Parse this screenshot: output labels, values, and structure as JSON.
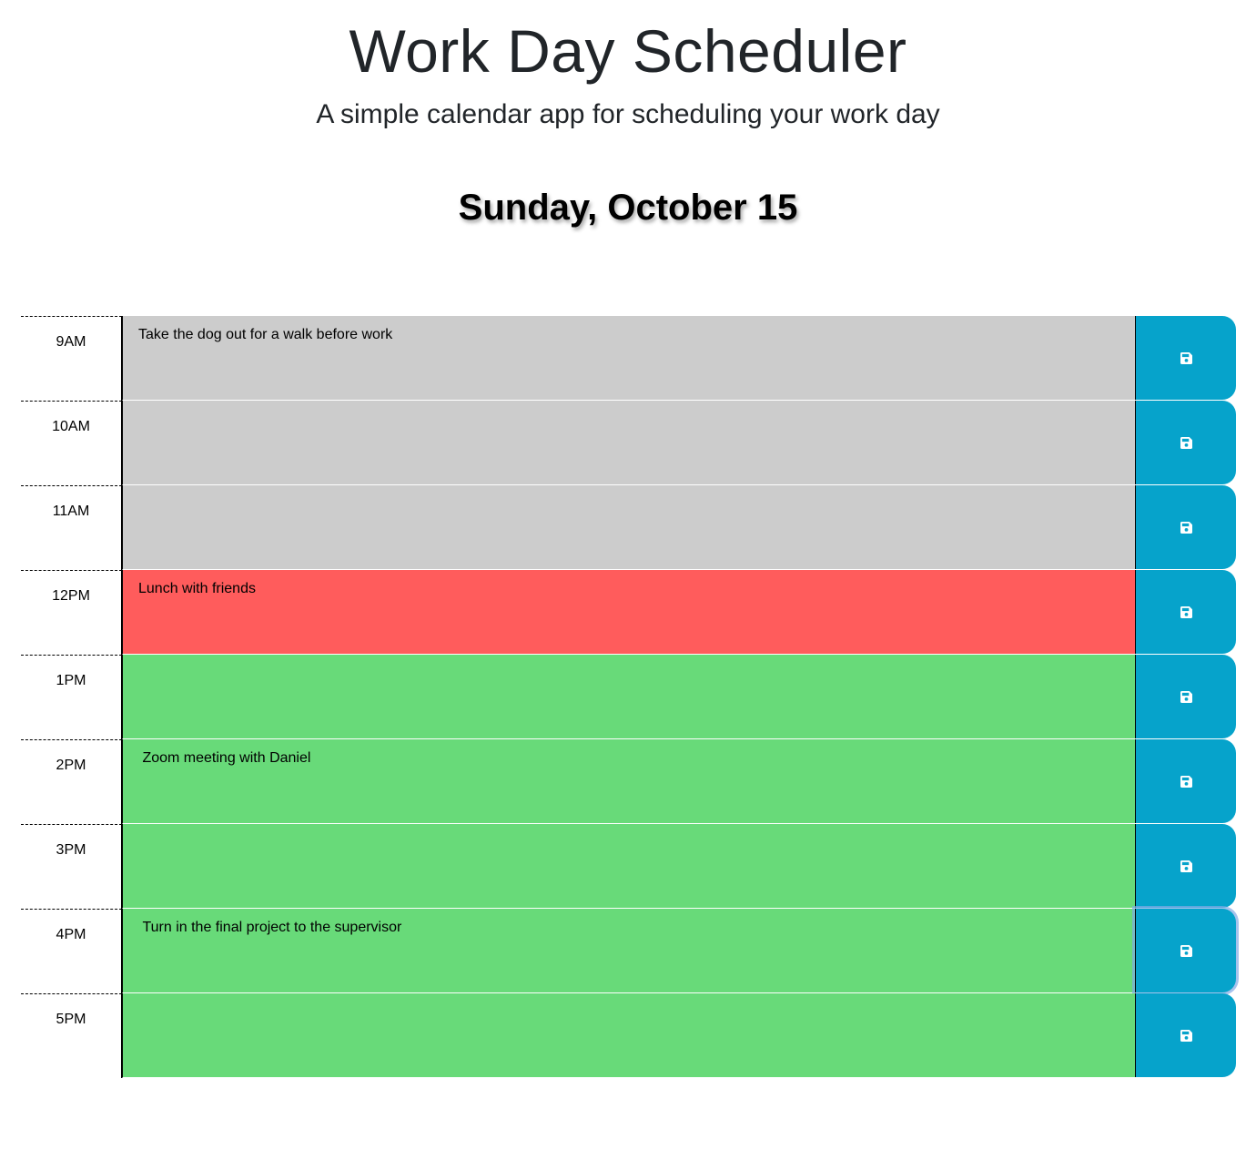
{
  "header": {
    "title": "Work Day Scheduler",
    "subtitle": "A simple calendar app for scheduling your work day",
    "current_day": "Sunday, October 15"
  },
  "colors": {
    "past": "#cccccc",
    "present": "#ff5c5c",
    "future": "#68da79",
    "save_button": "#06a3cb"
  },
  "schedule": [
    {
      "hour": "9AM",
      "text": "Take the dog out for a walk before work",
      "state": "past",
      "save_icon": "floppy-disk-icon"
    },
    {
      "hour": "10AM",
      "text": "",
      "state": "past",
      "save_icon": "floppy-disk-icon"
    },
    {
      "hour": "11AM",
      "text": "",
      "state": "past",
      "save_icon": "floppy-disk-icon"
    },
    {
      "hour": "12PM",
      "text": "Lunch with friends",
      "state": "present",
      "save_icon": "floppy-disk-icon"
    },
    {
      "hour": "1PM",
      "text": "",
      "state": "future",
      "save_icon": "floppy-disk-icon"
    },
    {
      "hour": "2PM",
      "text": " Zoom meeting with Daniel",
      "state": "future",
      "save_icon": "floppy-disk-icon"
    },
    {
      "hour": "3PM",
      "text": "",
      "state": "future",
      "save_icon": "floppy-disk-icon"
    },
    {
      "hour": "4PM",
      "text": " Turn in the final project to the supervisor",
      "state": "future",
      "save_icon": "floppy-disk-icon"
    },
    {
      "hour": "5PM",
      "text": "",
      "state": "future",
      "save_icon": "floppy-disk-icon"
    }
  ]
}
